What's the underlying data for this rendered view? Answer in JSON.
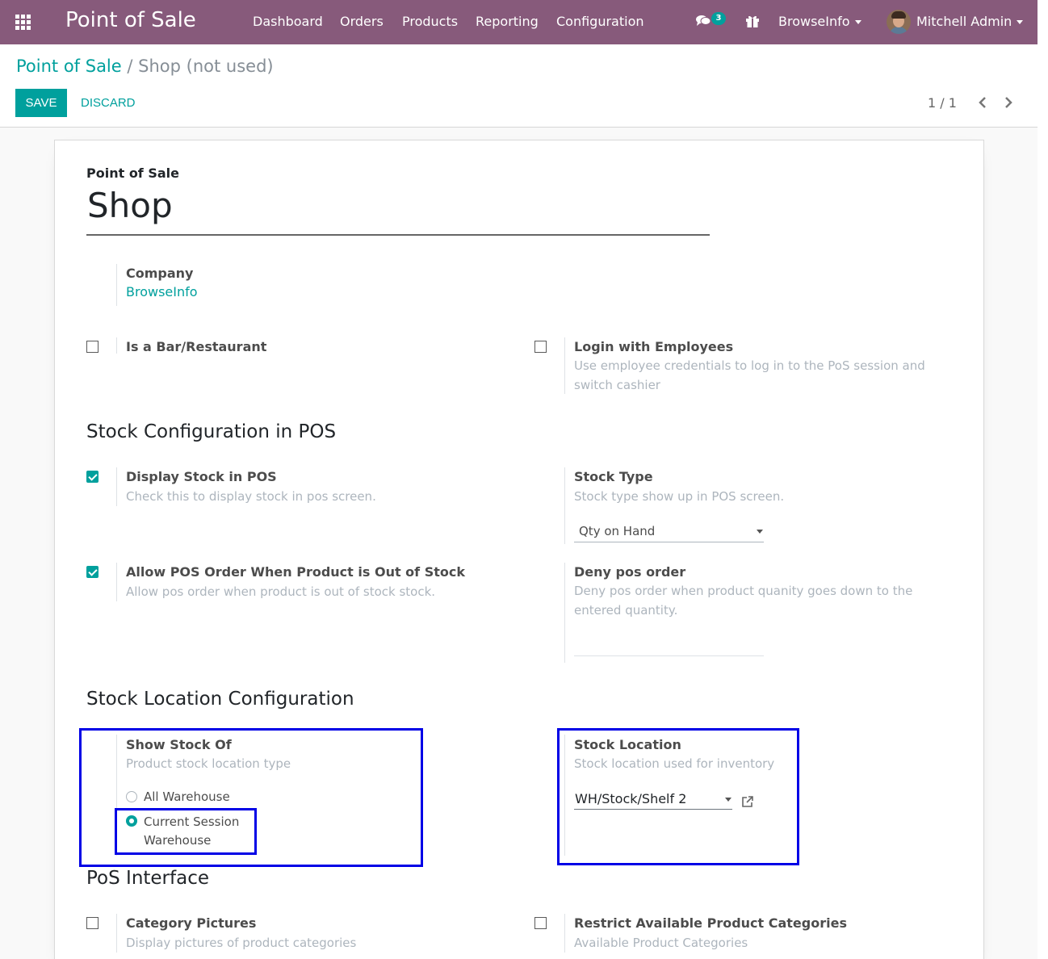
{
  "navbar": {
    "brand": "Point of Sale",
    "menu": [
      "Dashboard",
      "Orders",
      "Products",
      "Reporting",
      "Configuration"
    ],
    "chat_count": "3",
    "company_switcher": "BrowseInfo",
    "user": "Mitchell Admin"
  },
  "breadcrumb": {
    "parent": "Point of Sale",
    "separator": "/",
    "current": "Shop (not used)"
  },
  "buttons": {
    "save": "SAVE",
    "discard": "DISCARD"
  },
  "pager": {
    "value": "1 / 1"
  },
  "form": {
    "name_label": "Point of Sale",
    "name_value": "Shop",
    "company_label": "Company",
    "company_value": "BrowseInfo",
    "bar_restaurant": {
      "label": "Is a Bar/Restaurant",
      "checked": false
    },
    "login_employees": {
      "label": "Login with Employees",
      "help": "Use employee credentials to log in to the PoS session and switch cashier",
      "checked": false
    },
    "section_stock_config": "Stock Configuration in POS",
    "display_stock": {
      "label": "Display Stock in POS",
      "help": "Check this to display stock in pos screen.",
      "checked": true
    },
    "stock_type": {
      "label": "Stock Type",
      "help": "Stock type show up in POS screen.",
      "value": "Qty on Hand"
    },
    "allow_order_oos": {
      "label": "Allow POS Order When Product is Out of Stock",
      "help": "Allow pos order when product is out of stock stock.",
      "checked": true
    },
    "deny_order": {
      "label": "Deny pos order",
      "help": "Deny pos order when product quanity goes down to the entered quantity.",
      "value": ""
    },
    "section_location_config": "Stock Location Configuration",
    "show_stock_of": {
      "label": "Show Stock Of",
      "help": "Product stock location type",
      "options": [
        "All Warehouse",
        "Current Session Warehouse"
      ],
      "selected": "Current Session Warehouse"
    },
    "stock_location": {
      "label": "Stock Location",
      "help": "Stock location used for inventory",
      "value": "WH/Stock/Shelf 2"
    },
    "section_interface": "PoS Interface",
    "category_pictures": {
      "label": "Category Pictures",
      "help": "Display pictures of product categories",
      "checked": false
    },
    "restrict_categories": {
      "label": "Restrict Available Product Categories",
      "help": "Available Product Categories",
      "checked": false
    }
  },
  "colors": {
    "navbar": "#875a7b",
    "accent": "#00a09d",
    "highlight": "#0000e6"
  }
}
